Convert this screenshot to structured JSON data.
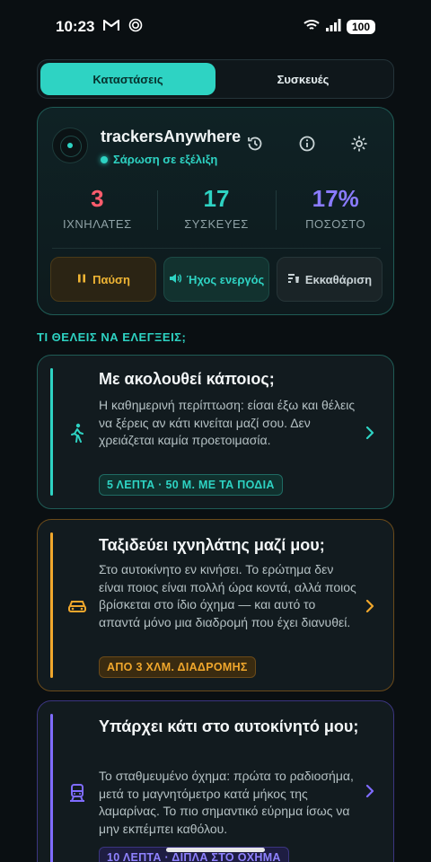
{
  "status_bar": {
    "time": "10:23",
    "battery": "100"
  },
  "tabs": [
    {
      "label": "Καταστάσεις",
      "active": true
    },
    {
      "label": "Συσκευές",
      "active": false
    }
  ],
  "scan_card": {
    "app_name": "trackersAnywhere",
    "status": "Σάρωση σε εξέλιξη",
    "stats": [
      {
        "value": "3",
        "label": "ΙΧΝΗΛΑΤΕΣ",
        "color": "#ff5c6c"
      },
      {
        "value": "17",
        "label": "ΣΥΣΚΕΥΕΣ",
        "color": "#2ed3c3"
      },
      {
        "value": "17%",
        "label": "ΠΟΣΟΣΤΟ",
        "color": "#8a7bff"
      }
    ],
    "actions": {
      "pause": "Παύση",
      "sound": "Ήχος ενεργός",
      "clear": "Εκκαθάριση"
    }
  },
  "section_title": "ΤΙ ΘΕΛΕΙΣ ΝΑ ΕΛΕΓΞΕΙΣ;",
  "questions": [
    {
      "title": "Με ακολουθεί κάποιος;",
      "description": "Η καθημερινή περίπτωση: είσαι έξω και θέλεις να ξέρεις αν κάτι κινείται μαζί σου. Δεν χρειάζεται καμία προετοιμασία.",
      "tag": "5 ΛΕΠΤΑ · 50 Μ. ΜΕ ΤΑ ΠΟΔΙΑ",
      "accent": "#2ed3c3",
      "icon": "walking-icon"
    },
    {
      "title": "Ταξιδεύει ιχνηλάτης μαζί μου;",
      "description": "Στο αυτοκίνητο εν κινήσει. Το ερώτημα δεν είναι ποιος είναι πολλή ώρα κοντά, αλλά ποιος βρίσκεται στο ίδιο όχημα — και αυτό το απαντά μόνο μια διαδρομή που έχει διανυθεί.",
      "tag": "ΑΠΟ 3 ΧΛΜ. ΔΙΑΔΡΟΜΗΣ",
      "accent": "#f0a72c",
      "icon": "car-icon"
    },
    {
      "title": "Υπάρχει κάτι στο αυτοκίνητό μου;",
      "description": "Το σταθμευμένο όχημα: πρώτα το ραδιοσήμα, μετά το μαγνητόμετρο κατά μήκος της λαμαρίνας. Το πιο σημαντικό εύρημα ίσως να μην εκπέμπει καθόλου.",
      "tag": "10 ΛΕΠΤΑ · ΔΙΠΛΑ ΣΤΟ ΟΧΗΜΑ",
      "accent": "#7f6cff",
      "icon": "vehicle-icon"
    }
  ]
}
